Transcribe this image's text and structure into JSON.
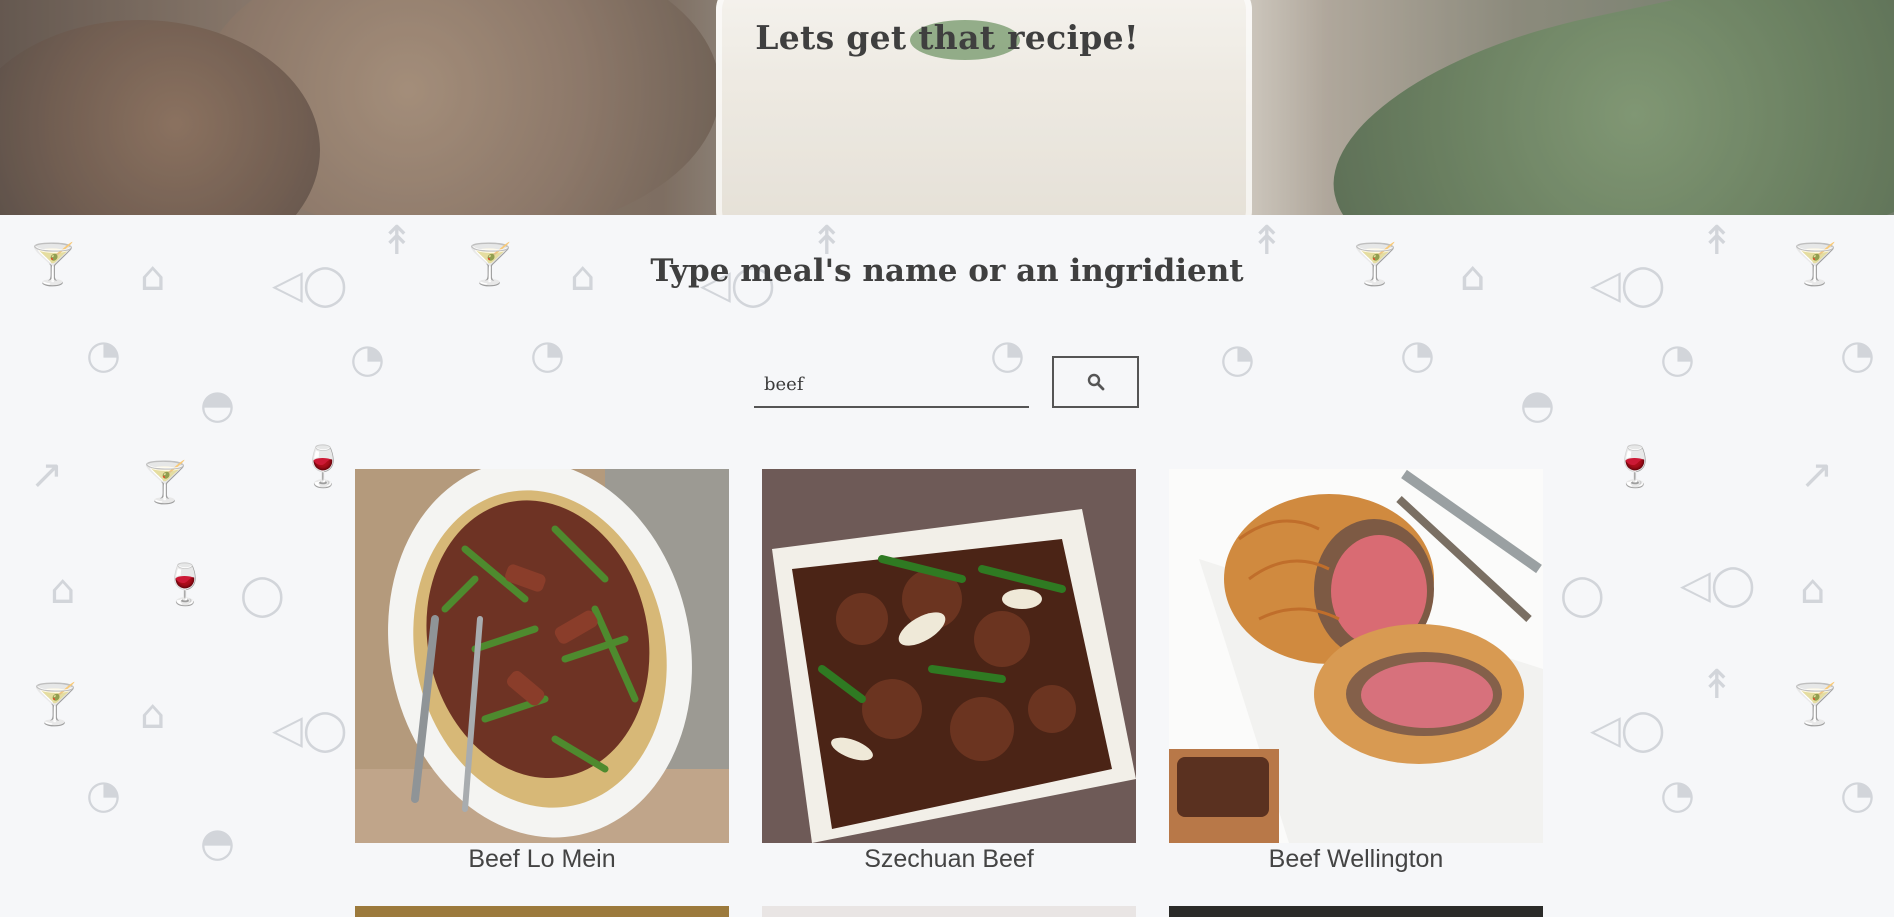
{
  "hero": {
    "title": "Lets get that recipe!"
  },
  "search": {
    "heading": "Type meal's name or an ingridient",
    "value": "beef",
    "button_icon": "search-icon"
  },
  "results": [
    {
      "name": "Beef Lo Mein"
    },
    {
      "name": "Szechuan Beef"
    },
    {
      "name": "Beef Wellington"
    }
  ],
  "pattern_icons": [
    "carrot",
    "cocktail",
    "chef-hat",
    "fish",
    "oven-mitt",
    "burger",
    "wine-glass",
    "egg"
  ]
}
